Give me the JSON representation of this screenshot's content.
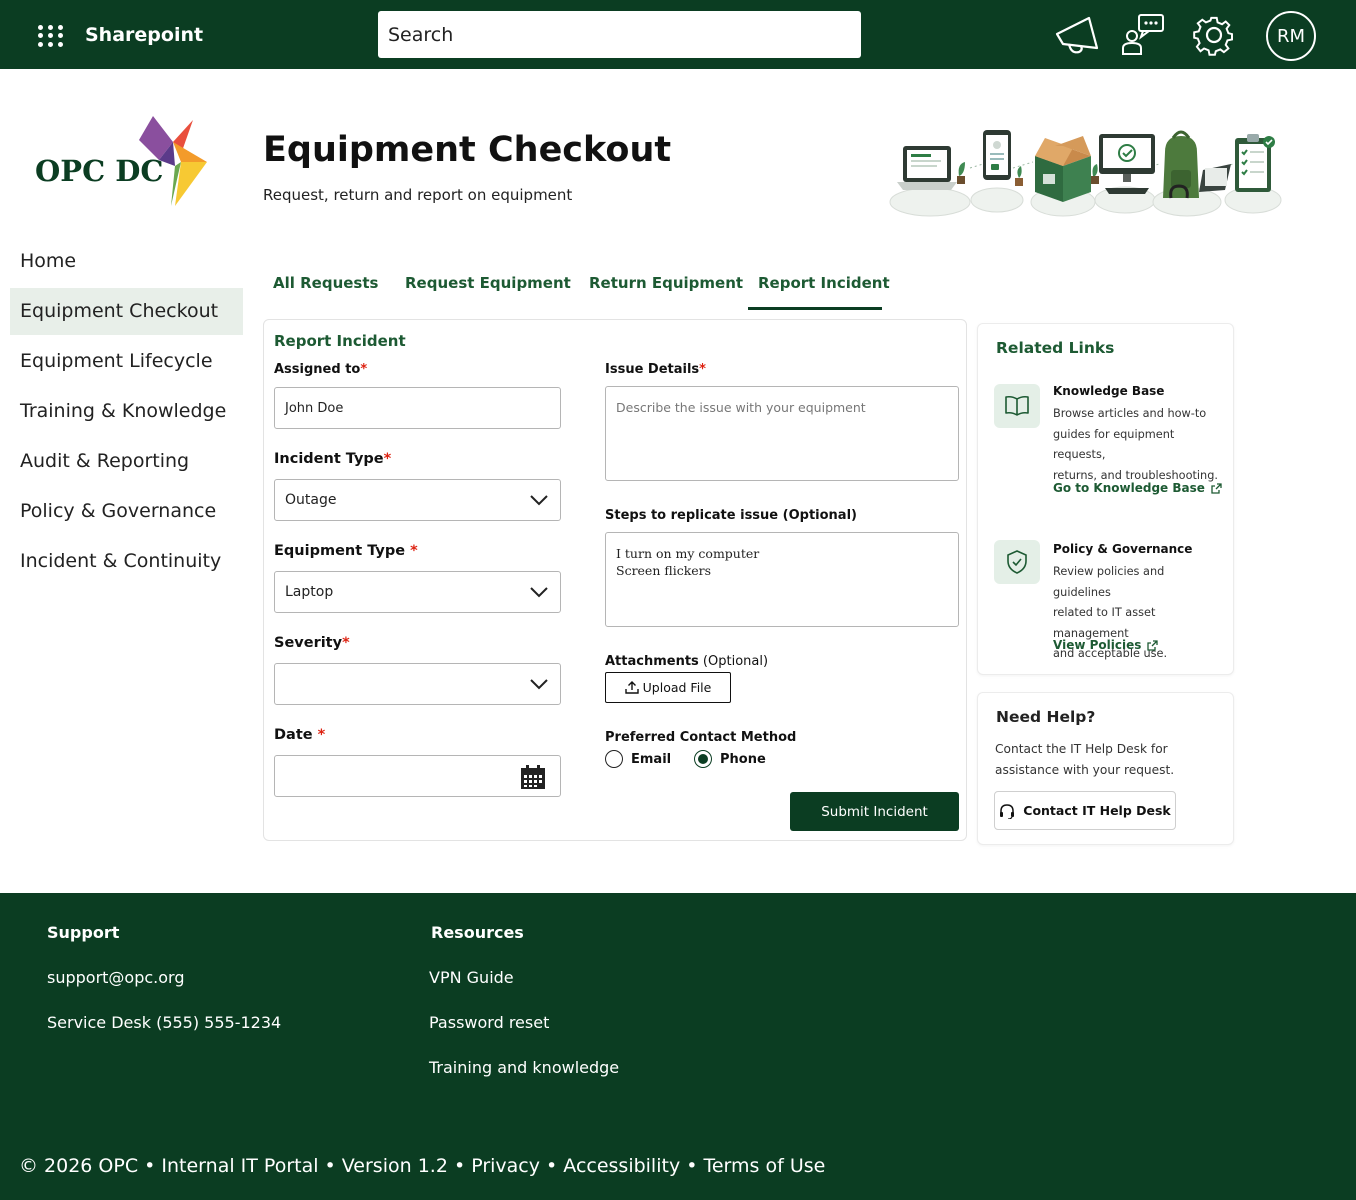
{
  "topbar": {
    "app_name": "Sharepoint",
    "search_placeholder": "Search",
    "icons": [
      "waffle-icon",
      "megaphone-icon",
      "chat-user-icon",
      "gear-icon"
    ],
    "avatar_initials": "RM"
  },
  "logo": {
    "text": "OPC DC"
  },
  "header": {
    "title": "Equipment Checkout",
    "subtitle": "Request, return and report on equipment"
  },
  "sidebar": {
    "items": [
      {
        "label": "Home",
        "active": false
      },
      {
        "label": "Equipment Checkout",
        "active": true
      },
      {
        "label": "Equipment Lifecycle",
        "active": false
      },
      {
        "label": "Training & Knowledge",
        "active": false
      },
      {
        "label": "Audit & Reporting",
        "active": false
      },
      {
        "label": "Policy & Governance",
        "active": false
      },
      {
        "label": "Incident & Continuity",
        "active": false
      }
    ]
  },
  "tabs": [
    {
      "label": "All Requests",
      "active": false
    },
    {
      "label": "Request Equipment",
      "active": false
    },
    {
      "label": "Return Equipment",
      "active": false
    },
    {
      "label": "Report Incident",
      "active": true
    }
  ],
  "form": {
    "title": "Report Incident",
    "assigned_to": {
      "label": "Assigned to",
      "required_mark": "*",
      "value": "John Doe"
    },
    "incident_type": {
      "label": "Incident Type",
      "required_mark": "*",
      "value": "Outage"
    },
    "equipment_type": {
      "label": "Equipment Type ",
      "required_mark": "*",
      "value": "Laptop"
    },
    "severity": {
      "label": "Severity",
      "required_mark": "*",
      "value": ""
    },
    "date": {
      "label": "Date ",
      "required_mark": "*",
      "value": ""
    },
    "issue_details": {
      "label": "Issue Details",
      "required_mark": "*",
      "placeholder": "Describe the issue with your equipment"
    },
    "steps": {
      "label": "Steps to replicate issue (Optional)",
      "lines": [
        "I turn on my computer",
        "Screen flickers"
      ]
    },
    "attachments": {
      "label": "Attachments",
      "optional": " (Optional)",
      "button": "Upload File"
    },
    "contact": {
      "label": "Preferred Contact Method",
      "options": [
        {
          "label": "Email",
          "selected": false
        },
        {
          "label": "Phone",
          "selected": true
        }
      ]
    },
    "submit_label": "Submit Incident"
  },
  "related_links": {
    "title": "Related Links",
    "items": [
      {
        "icon": "book-icon",
        "heading": "Knowledge Base",
        "desc_lines": [
          "Browse articles and how-to",
          "guides for equipment requests,",
          "returns, and troubleshooting."
        ],
        "link": "Go to Knowledge Base"
      },
      {
        "icon": "shield-check-icon",
        "heading": "Policy & Governance",
        "desc_lines": [
          "Review policies and guidelines",
          "related to IT asset management",
          "and acceptable use."
        ],
        "link": "View Policies"
      }
    ]
  },
  "help": {
    "title": "Need Help?",
    "text_lines": [
      "Contact the IT Help Desk for",
      "assistance with your request."
    ],
    "button": "Contact IT Help Desk"
  },
  "footer": {
    "support": {
      "heading": "Support",
      "links": [
        "support@opc.org",
        "Service Desk (555) 555-1234"
      ]
    },
    "resources": {
      "heading": "Resources",
      "links": [
        "VPN Guide",
        "Password reset",
        "Training and knowledge"
      ]
    },
    "copyright": "© 2026 OPC • Internal IT Portal • Version 1.2 • Privacy • Accessibility • Terms of Use"
  },
  "colors": {
    "brand_green": "#0b3d22",
    "accent_green": "#1d5a33",
    "required": "#dd2211"
  }
}
